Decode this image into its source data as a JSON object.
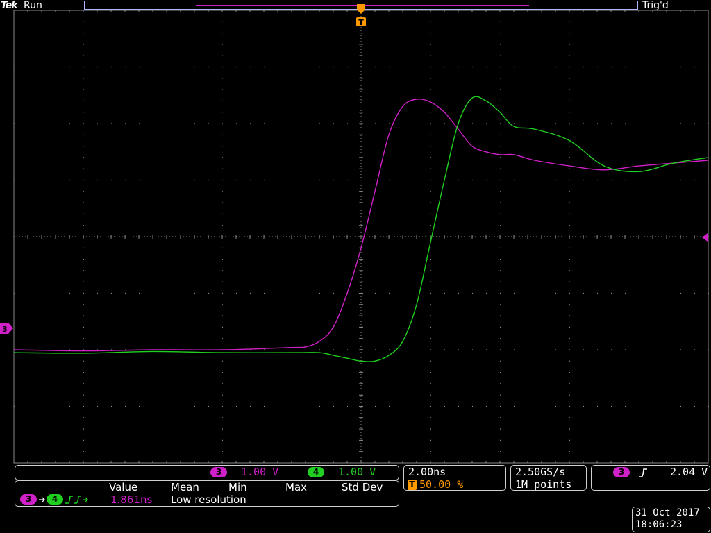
{
  "brand": "Tek",
  "acq_state": "Run",
  "trigger_state": "Trig'd",
  "trigger_marker": "T",
  "colors": {
    "ch3": "#d020c8",
    "ch4": "#20d020",
    "accent": "#ff9900",
    "grid": "#8a8a8a"
  },
  "channels": {
    "ch3": {
      "id": "3",
      "scale": "1.00 V"
    },
    "ch4": {
      "id": "4",
      "scale": "1.00 V"
    }
  },
  "measurements": {
    "headers": [
      "Value",
      "Mean",
      "Min",
      "Max",
      "Std Dev"
    ],
    "source_from": "3",
    "source_to": "4",
    "value": "1.861ns",
    "note": "Low resolution"
  },
  "horizontal": {
    "scale": "2.00ns",
    "position": "50.00 %"
  },
  "acquisition": {
    "sample_rate": "2.50GS/s",
    "record": "1M points"
  },
  "trigger": {
    "source": "3",
    "level": "2.04 V",
    "slope_icon": "rising-edge-icon"
  },
  "datetime": {
    "date": "31 Oct  2017",
    "time": "18:06:23"
  },
  "chart_data": {
    "type": "line",
    "xlabel": "",
    "ylabel": "",
    "x_unit": "div",
    "y_unit": "div",
    "xlim": [
      -5,
      5
    ],
    "ylim": [
      -4,
      4
    ],
    "grid": true,
    "series": [
      {
        "name": "",
        "color": "#d020c8",
        "x": [
          -5,
          -4,
          -3,
          -2,
          -1,
          -0.8,
          -0.6,
          -0.4,
          -0.2,
          0,
          0.2,
          0.4,
          0.6,
          0.8,
          1,
          1.2,
          1.4,
          1.6,
          1.8,
          2,
          2.2,
          2.5,
          3,
          3.5,
          4,
          4.5,
          5
        ],
        "y": [
          -2.0,
          -2.02,
          -2.0,
          -2.0,
          -1.96,
          -1.95,
          -1.85,
          -1.6,
          -1.0,
          -0.2,
          0.8,
          1.8,
          2.3,
          2.43,
          2.38,
          2.2,
          1.9,
          1.6,
          1.5,
          1.45,
          1.45,
          1.35,
          1.25,
          1.18,
          1.25,
          1.3,
          1.35
        ]
      },
      {
        "name": "",
        "color": "#20d020",
        "x": [
          -5,
          -4,
          -3,
          -2,
          -1,
          -0.6,
          -0.4,
          -0.2,
          0,
          0.2,
          0.4,
          0.6,
          0.8,
          1,
          1.2,
          1.4,
          1.6,
          1.8,
          2,
          2.2,
          2.5,
          3,
          3.5,
          4,
          4.5,
          5
        ],
        "y": [
          -2.05,
          -2.06,
          -2.03,
          -2.05,
          -2.05,
          -2.05,
          -2.1,
          -2.15,
          -2.2,
          -2.2,
          -2.1,
          -1.85,
          -1.2,
          -0.1,
          1.0,
          2.0,
          2.45,
          2.4,
          2.2,
          1.95,
          1.9,
          1.7,
          1.25,
          1.15,
          1.3,
          1.4
        ]
      }
    ]
  }
}
